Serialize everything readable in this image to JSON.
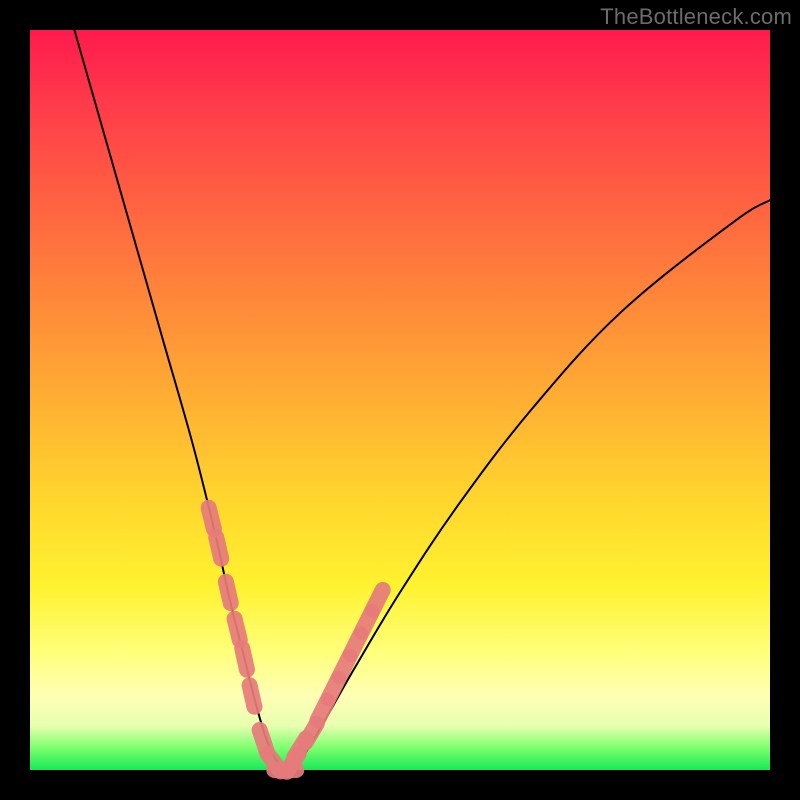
{
  "watermark": "TheBottleneck.com",
  "chart_data": {
    "type": "line",
    "title": "",
    "xlabel": "",
    "ylabel": "",
    "xlim": [
      0,
      100
    ],
    "ylim": [
      0,
      100
    ],
    "grid": false,
    "legend": false,
    "series": [
      {
        "name": "black-curve",
        "color": "#000000",
        "x": [
          6,
          10,
          14,
          18,
          22,
          25,
          27,
          29,
          30.5,
          32,
          33.5,
          35,
          37,
          40,
          44,
          50,
          58,
          68,
          80,
          95,
          100
        ],
        "y": [
          100,
          86,
          72,
          58,
          44,
          32,
          23,
          15,
          9,
          4,
          1,
          0,
          2,
          7,
          14,
          24,
          36,
          49,
          62,
          74,
          77
        ]
      },
      {
        "name": "pink-dots",
        "color": "#e77b7b",
        "x": [
          24.5,
          25.5,
          26.8,
          28.0,
          29.0,
          30.0,
          31.5,
          33.0,
          34.5,
          35.5,
          36.5,
          38.0,
          39.5,
          41.0,
          42.5,
          44.0,
          45.5,
          47.0
        ],
        "y": [
          34.0,
          30.0,
          24.0,
          19.0,
          15.0,
          10.0,
          4.0,
          1.0,
          0.0,
          1.0,
          3.0,
          5.0,
          8.0,
          11.0,
          14.0,
          17.0,
          20.0,
          23.0
        ]
      }
    ],
    "annotations": []
  }
}
